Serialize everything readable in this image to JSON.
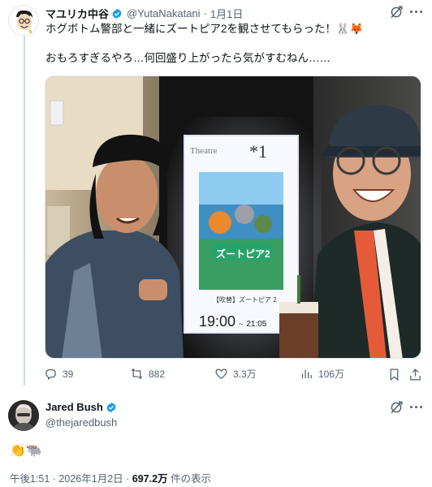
{
  "tweet": {
    "display_name": "マユリカ中谷",
    "handle": "@YutaNakatani",
    "separator": "·",
    "time": "1月1日",
    "text_line1": "ホグボトム警部と一緒にズートピア2を観させてもらった！🐰🦊",
    "text_line2": "おもろすぎるやろ…何回盛り上がったら気がすむねん……",
    "photo": {
      "theatre_label": "Theatre",
      "theatre_number": "*1",
      "poster_title": "ズートピア2",
      "poster_caption": "【吹替】ズートピア 2",
      "showtime_start": "19:00",
      "showtime_sep": "~",
      "showtime_end": "21:05"
    },
    "replies": "39",
    "reposts": "882",
    "likes": "3.3万",
    "views": "106万"
  },
  "reply": {
    "display_name": "Jared Bush",
    "handle": "@thejaredbush",
    "text": "👏🐃",
    "timestamp": "午後1:51 · 2026年1月2日 · ",
    "views_count": "697.2万",
    "views_suffix": " 件の表示"
  },
  "colors": {
    "verified": "#1d9bf0",
    "secondary_text": "#536471",
    "thread_line": "#cfd9de"
  }
}
